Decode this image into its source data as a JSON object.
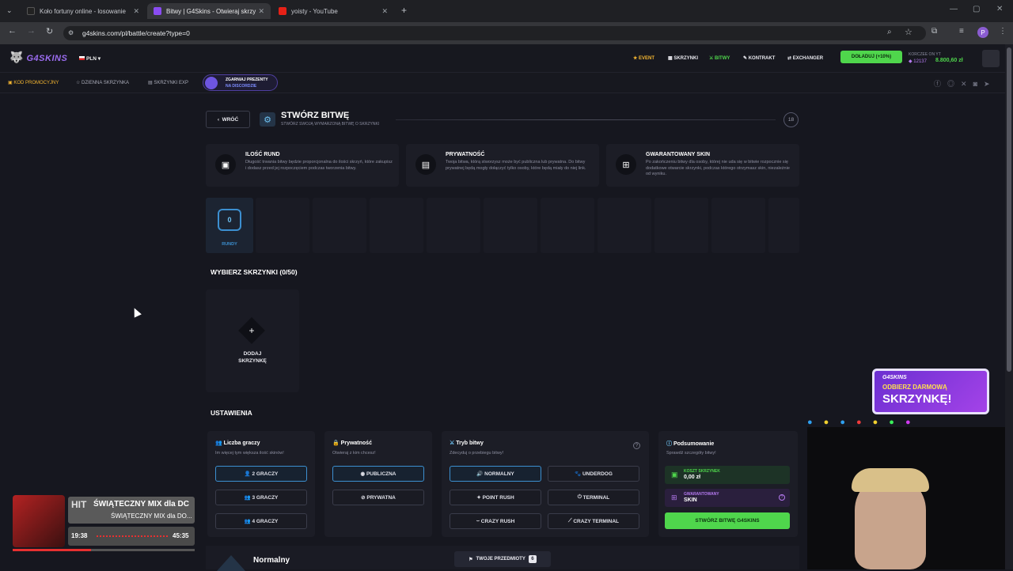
{
  "browser": {
    "tabs": [
      {
        "title": "Koło fortuny online - losowanie"
      },
      {
        "title": "Bitwy | G4Skins - Otwieraj skrzy"
      },
      {
        "title": "yoisty - YouTube"
      }
    ],
    "url": "g4skins.com/pl/battle/create?type=0",
    "profile_initial": "P"
  },
  "site": {
    "logo": "G4SKINS",
    "currency": "PLN",
    "nav": [
      "EVENT",
      "SKRZYNKI",
      "BITWY",
      "KONTRAKT",
      "EXCHANGER"
    ],
    "topup": "DOŁADUJ (+10%)",
    "yt_label": "KORCZEE ON YT",
    "points": "12137",
    "balance": "8.800,60 zł",
    "subnav": [
      "KOD PROMOCYJNY",
      "DZIENNA SKRZYNKA",
      "SKRZYNKI EXP"
    ],
    "discord_promo": {
      "line1": "ZGARNIAJ PREZENTY",
      "line2": "NA DISCORDZIE"
    }
  },
  "page": {
    "back": "WRÓĆ",
    "title": "STWÓRZ BITWĘ",
    "subtitle": "STWÓRZ SWOJĄ WYMARZONĄ BITWĘ O SKRZYNKI",
    "age": "18",
    "info": [
      {
        "title": "ILOŚĆ RUND",
        "text": "Długość trwania bitwy będzie proporcjonalna do ilości skrzyń, które zakupisz i dodasz przed jej rozpoczęciem podczas tworzenia bitwy."
      },
      {
        "title": "PRYWATNOŚĆ",
        "text": "Twoja bitwa, którą stworzysz może być publiczna lub prywatna. Do bitwy prywatnej będą mogły dołączyć tylko osoby, które będą miały do niej link."
      },
      {
        "title": "GWARANTOWANY SKIN",
        "text": "Po zakończeniu bitwy dla osoby, której nie uda się w bitwie rozpocznie się dodatkowe otwarcie skrzynki, podczas którego otrzymasz skin, niezależnie od wyniku."
      }
    ],
    "rounds_value": "0",
    "rounds_label": "RUNDY",
    "choose_cases": "WYBIERZ SKRZYNKI (0/50)",
    "add_case": "DODAJ SKRZYNKĘ",
    "settings": "USTAWIENIA",
    "players": {
      "title": "Liczba graczy",
      "desc": "Im więcej tym większa ilość skinów!",
      "options": [
        "2 GRACZY",
        "3 GRACZY",
        "4 GRACZY"
      ]
    },
    "privacy": {
      "title": "Prywatność",
      "desc": "Otwieraj z kim chcesz!",
      "options": [
        "PUBLICZNA",
        "PRYWATNA"
      ]
    },
    "mode": {
      "title": "Tryb bitwy",
      "desc": "Zdecyduj o przebiegu bitwy!",
      "options": [
        "NORMALNY",
        "UNDERDOG",
        "POINT RUSH",
        "TERMINAL",
        "CRAZY RUSH",
        "CRAZY TERMINAL"
      ]
    },
    "summary": {
      "title": "Podsumowanie",
      "desc": "Sprawdź szczegóły bitwy!",
      "cost_label": "KOSZT SKRZYNEK",
      "cost_value": "0,00 zł",
      "guar_label": "GWARANTOWANY",
      "guar_value": "SKIN",
      "create": "STWÓRZ BITWĘ G4SKINS"
    },
    "mode_name": "Normalny",
    "your_items": "TWOJE PRZEDMIOTY",
    "your_items_count": "6"
  },
  "overlays": {
    "promo_banner": {
      "brand": "G4SKINS",
      "line1": "ODBIERZ DARMOWĄ",
      "line2": "SKRZYNKĘ!"
    },
    "music": {
      "title": "ŚWIĄTECZNY MIX dla DC",
      "sub": "ŚWIĄTECZNY MIX dla DO...",
      "tag": "HIT",
      "elapsed": "19:38",
      "total": "45:35",
      "progress": 0.43
    }
  },
  "colors": {
    "accent_green": "#4fd64c",
    "accent_blue": "#3c8fd0",
    "event_gold": "#f3b531"
  }
}
